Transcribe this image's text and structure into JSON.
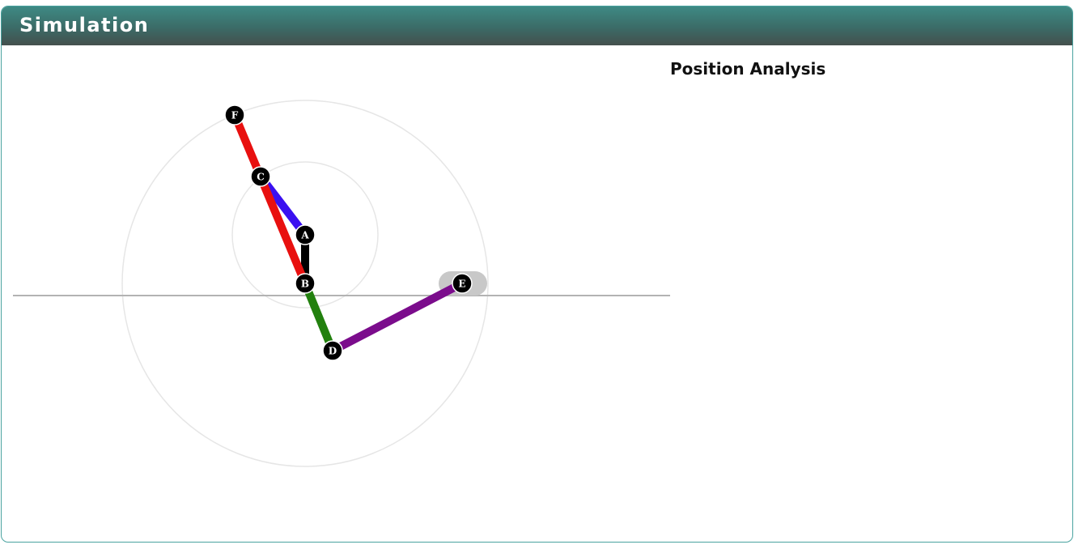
{
  "panel": {
    "title": "Simulation"
  },
  "analysis": {
    "title": "Position Analysis"
  },
  "mechanism": {
    "links": [
      {
        "from": "A",
        "to": "B",
        "color": "#000000"
      },
      {
        "from": "C",
        "to": "A",
        "color": "#3a10f0"
      },
      {
        "from": "F",
        "to": "B",
        "color": "#e8100f"
      },
      {
        "from": "B",
        "to": "D",
        "color": "#22800e"
      },
      {
        "from": "D",
        "to": "E",
        "color": "#7b0c8c"
      }
    ],
    "joints": [
      {
        "label": "A"
      },
      {
        "label": "B"
      },
      {
        "label": "C"
      },
      {
        "label": "D"
      },
      {
        "label": "E"
      },
      {
        "label": "F"
      }
    ],
    "colors": {
      "ground_line": "#b3b3b3",
      "guide_circle": "#e6e6e6",
      "slider": "#c8c8c8",
      "joint_fill": "#000000",
      "joint_label": "#ffffff"
    }
  }
}
